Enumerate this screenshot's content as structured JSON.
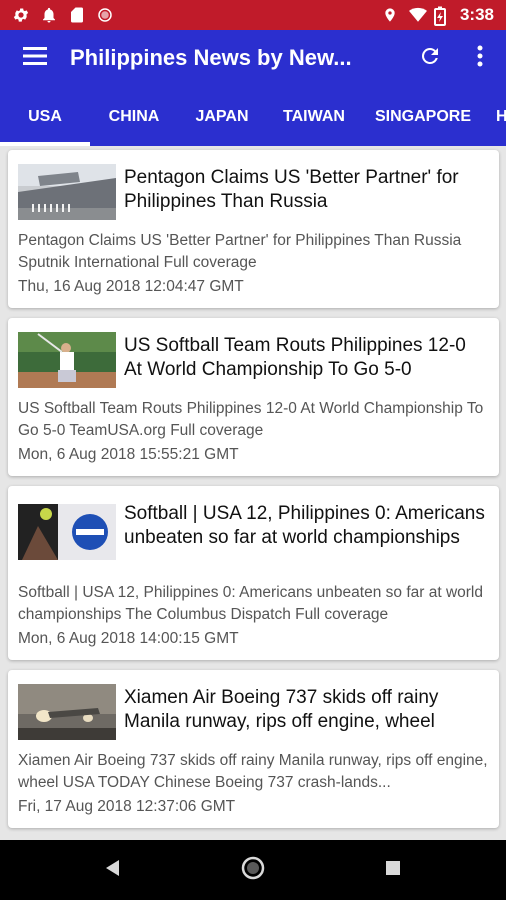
{
  "status_bar": {
    "time": "3:38",
    "icons": [
      "gear-icon",
      "notification-bell-icon",
      "sd-card-icon",
      "record-icon",
      "location-icon",
      "wifi-icon",
      "battery-charging-icon"
    ]
  },
  "app_bar": {
    "title": "Philippines News by New...",
    "icons": [
      "menu-icon",
      "refresh-icon",
      "more-vertical-icon"
    ]
  },
  "tabs": [
    {
      "label": "USA",
      "active": true
    },
    {
      "label": "CHINA",
      "active": false
    },
    {
      "label": "JAPAN",
      "active": false
    },
    {
      "label": "TAIWAN",
      "active": false
    },
    {
      "label": "SINGAPORE",
      "active": false
    },
    {
      "label": "H",
      "active": false
    }
  ],
  "articles": [
    {
      "title": "Pentagon Claims US 'Better Partner' for Philippines Than Russia",
      "description": "Pentagon Claims US 'Better Partner' for Philippines Than Russia  Sputnik International  Full coverage",
      "date": "Thu, 16 Aug 2018 12:04:47 GMT"
    },
    {
      "title": "US Softball Team Routs Philippines 12-0 At World Championship To Go 5-0",
      "description": "US Softball Team Routs Philippines 12-0 At World Championship To Go 5-0  TeamUSA.org  Full coverage",
      "date": "Mon, 6 Aug 2018 15:55:21 GMT"
    },
    {
      "title": "Softball | USA 12, Philippines 0: Americans unbeaten so far at world championships",
      "description": "Softball | USA 12, Philippines 0: Americans unbeaten so far at world championships  The Columbus Dispatch  Full coverage",
      "date": "Mon, 6 Aug 2018 14:00:15 GMT"
    },
    {
      "title": "Xiamen Air Boeing 737 skids off rainy Manila runway, rips off engine, wheel",
      "description": "Xiamen Air Boeing 737 skids off rainy Manila runway, rips off engine, wheel  USA TODAY  Chinese Boeing 737 crash-lands...",
      "date": "Fri, 17 Aug 2018 12:37:06 GMT"
    }
  ],
  "colors": {
    "status_bar": "#c01b2a",
    "app_bar": "#2b2fcf",
    "background": "#e6e6e6",
    "card": "#ffffff"
  }
}
